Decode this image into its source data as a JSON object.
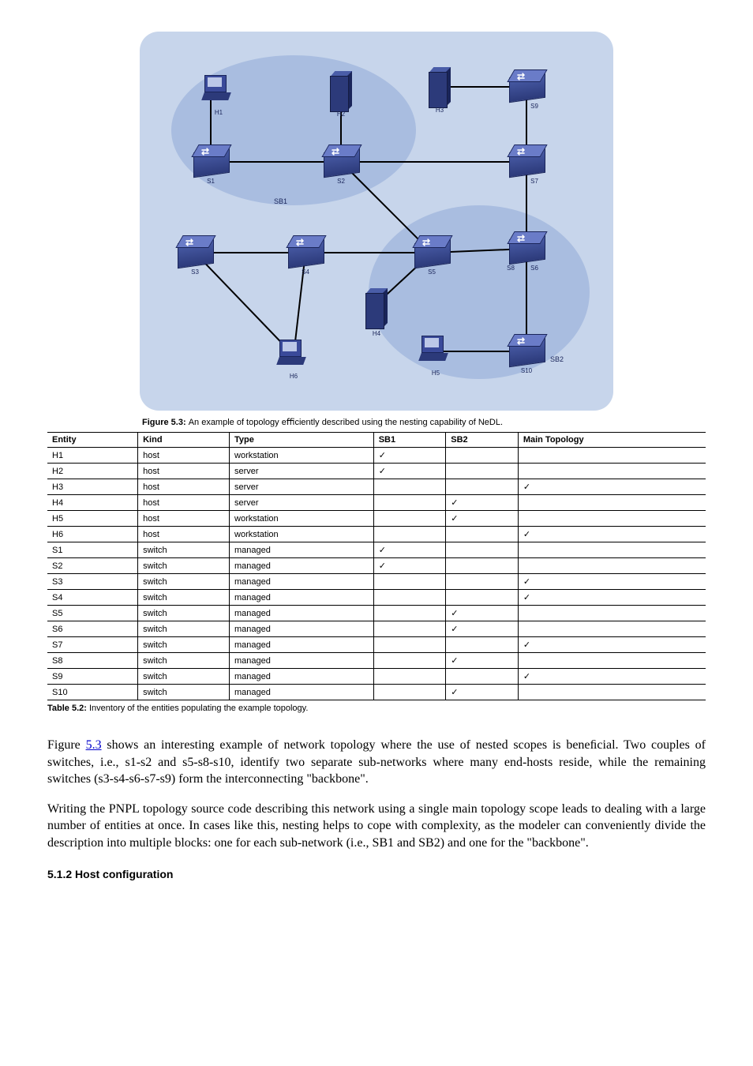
{
  "figure": {
    "caption_prefix": "Figure 5.3: ",
    "caption": "An example of topology eﬃciently described using the nesting capability of NeDL.",
    "regions": {
      "sb1": "SB1",
      "sb2": "SB2"
    },
    "nodes": {
      "h1": "H1",
      "h2": "H2",
      "h3": "H3",
      "h4": "H4",
      "h5": "H5",
      "h6": "H6",
      "s1": "S1",
      "s2": "S2",
      "s3": "S3",
      "s4": "S4",
      "s5": "S5",
      "s6": "S6",
      "s7": "S7",
      "s8": "S8",
      "s9": "S9",
      "s10": "S10"
    }
  },
  "table": {
    "caption_prefix": "Table 5.2: ",
    "caption": "Inventory of the entities populating the example topology.",
    "headers": [
      "Entity",
      "Kind",
      "Type",
      "SB1",
      "SB2",
      "Main Topology"
    ],
    "rows": [
      [
        "H1",
        "host",
        "workstation",
        "✓",
        "",
        ""
      ],
      [
        "H2",
        "host",
        "server",
        "✓",
        "",
        ""
      ],
      [
        "H3",
        "host",
        "server",
        "",
        "",
        "✓"
      ],
      [
        "H4",
        "host",
        "server",
        "",
        "✓",
        ""
      ],
      [
        "H5",
        "host",
        "workstation",
        "",
        "✓",
        ""
      ],
      [
        "H6",
        "host",
        "workstation",
        "",
        "",
        "✓"
      ],
      [
        "S1",
        "switch",
        "managed",
        "✓",
        "",
        ""
      ],
      [
        "S2",
        "switch",
        "managed",
        "✓",
        "",
        ""
      ],
      [
        "S3",
        "switch",
        "managed",
        "",
        "",
        "✓"
      ],
      [
        "S4",
        "switch",
        "managed",
        "",
        "",
        "✓"
      ],
      [
        "S5",
        "switch",
        "managed",
        "",
        "✓",
        ""
      ],
      [
        "S6",
        "switch",
        "managed",
        "",
        "✓",
        ""
      ],
      [
        "S7",
        "switch",
        "managed",
        "",
        "",
        "✓"
      ],
      [
        "S8",
        "switch",
        "managed",
        "",
        "✓",
        ""
      ],
      [
        "S9",
        "switch",
        "managed",
        "",
        "",
        "✓"
      ],
      [
        "S10",
        "switch",
        "managed",
        "",
        "✓",
        ""
      ]
    ]
  },
  "paragraphs": {
    "p1_a": "Figure ",
    "p1_link": "5.3",
    "p1_b": " shows an interesting example of network topology where the use of nested scopes is beneﬁcial. Two couples of switches, i.e., s1-s2 and s5-s8-s10, identify two separate sub-networks where many end-hosts reside, while the remaining switches (s3-s4-s6-s7-s9) form the interconnecting \"backbone\".",
    "p2": "Writing the PNPL topology source code describing this network using a single main topology scope leads to dealing with a large number of entities at once. In cases like this, nesting helps to cope with complexity, as the modeler can conveniently divide the description into multiple blocks: one for each sub-network (i.e., SB1 and SB2) and one for the \"backbone\"."
  },
  "heading": "5.1.2 Host conﬁguration"
}
